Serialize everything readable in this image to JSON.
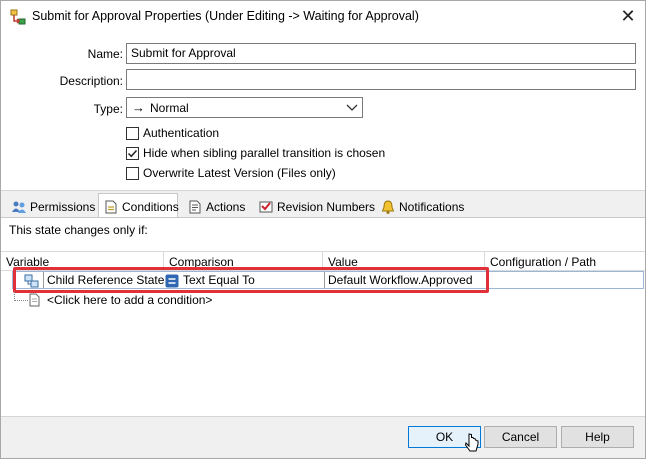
{
  "window": {
    "title": "Submit for Approval Properties (Under Editing -> Waiting for Approval)",
    "close_glyph": "✕",
    "icon": "transition-icon"
  },
  "form": {
    "name_label": "Name:",
    "name_value": "Submit for Approval",
    "description_label": "Description:",
    "description_value": "",
    "type_label": "Type:",
    "type_value": "Normal",
    "type_icon_glyph": "→",
    "checkboxes": [
      {
        "label": "Authentication",
        "checked": false
      },
      {
        "label": "Hide when sibling parallel transition is chosen",
        "checked": true
      },
      {
        "label": "Overwrite Latest Version (Files only)",
        "checked": false
      }
    ]
  },
  "tabs": [
    {
      "label": "Permissions",
      "icon": "users-icon",
      "active": false
    },
    {
      "label": "Conditions",
      "icon": "conditions-icon",
      "active": true
    },
    {
      "label": "Actions",
      "icon": "actions-icon",
      "active": false
    },
    {
      "label": "Revision Numbers",
      "icon": "revision-icon",
      "active": false
    },
    {
      "label": "Notifications",
      "icon": "bell-icon",
      "active": false
    }
  ],
  "conditions": {
    "intro": "This state changes only if:",
    "columns": [
      "Variable",
      "Comparison",
      "Value",
      "Configuration / Path"
    ],
    "rows": [
      {
        "variable": "Child Reference State",
        "comparison": "Text Equal To",
        "value": "Default Workflow.Approved",
        "path": ""
      }
    ],
    "add_prompt": "<Click here to add a condition>"
  },
  "buttons": {
    "ok": "OK",
    "cancel": "Cancel",
    "help": "Help"
  },
  "colors": {
    "highlight": "#e0313a",
    "default_button_border": "#0078d7"
  }
}
